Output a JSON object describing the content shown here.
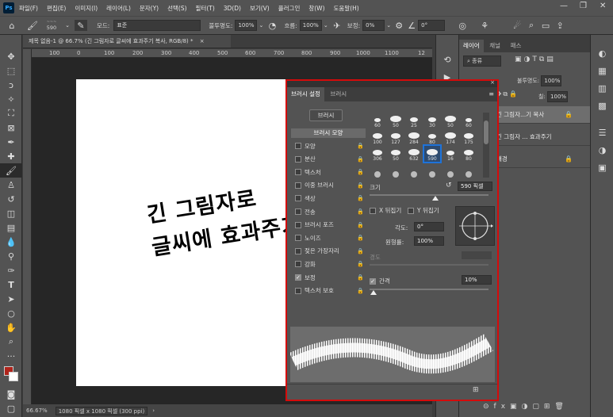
{
  "menubar": {
    "logo": "Ps",
    "items": [
      "파일(F)",
      "편집(E)",
      "이미지(I)",
      "레이어(L)",
      "문자(Y)",
      "선택(S)",
      "필터(T)",
      "3D(D)",
      "보기(V)",
      "플러그인",
      "창(W)",
      "도움말(H)"
    ]
  },
  "options": {
    "brush_size": "590",
    "mode_label": "모드:",
    "mode_value": "표준",
    "opacity_label": "불투명도:",
    "opacity_value": "100%",
    "flow_label": "흐름:",
    "flow_value": "100%",
    "smoothing_label": "보정:",
    "smoothing_value": "0%",
    "angle_value": "0°"
  },
  "document": {
    "tab_title": "제목 없음-1 @ 66.7% (긴 그림자로 글씨에 효과주기 복사, RGB/8) *",
    "text_line1": "긴 그림자로",
    "text_line2": "글씨에 효과주기",
    "ruler_ticks": [
      "100",
      "0",
      "100",
      "200",
      "300",
      "400",
      "500",
      "600",
      "700",
      "800",
      "900",
      "1000",
      "1100",
      "12"
    ]
  },
  "status": {
    "zoom": "66.67%",
    "size": "1080 픽셀 x 1080 픽셀 (300 ppi)"
  },
  "layers_panel": {
    "tabs": [
      "레이어",
      "채널",
      "패스"
    ],
    "filter_label": "종류",
    "opacity_label": "불투명도:",
    "opacity_value": "100%",
    "fill_label": "칠:",
    "fill_value": "100%",
    "layers": [
      {
        "name": "긴 그림자...기 복사",
        "selected": true
      },
      {
        "name": "긴 그림자 ... 효과주기",
        "selected": false
      },
      {
        "name": "배경",
        "selected": false
      }
    ]
  },
  "brush_settings": {
    "tabs": [
      "브러시 설정",
      "브러시"
    ],
    "brushes_button": "브러시",
    "shape_title": "브러시 모양",
    "options": [
      {
        "label": "모양",
        "checked": false,
        "locked": true
      },
      {
        "label": "분산",
        "checked": false,
        "locked": true
      },
      {
        "label": "텍스처",
        "checked": false,
        "locked": true
      },
      {
        "label": "이중 브러시",
        "checked": false,
        "locked": true
      },
      {
        "label": "색상",
        "checked": false,
        "locked": true
      },
      {
        "label": "전송",
        "checked": false,
        "locked": true
      },
      {
        "label": "브러시 포즈",
        "checked": false,
        "locked": true
      },
      {
        "label": "노이즈",
        "checked": false,
        "locked": true
      },
      {
        "label": "젖은 가장자리",
        "checked": false,
        "locked": true
      },
      {
        "label": "강화",
        "checked": false,
        "locked": true
      },
      {
        "label": "보정",
        "checked": true,
        "locked": true
      },
      {
        "label": "텍스처 보호",
        "checked": false,
        "locked": true
      }
    ],
    "tip_sizes": [
      "60",
      "50",
      "25",
      "30",
      "50",
      "60",
      "100",
      "127",
      "284",
      "80",
      "174",
      "175",
      "306",
      "50",
      "632",
      "590",
      "16",
      "80",
      "",
      "",
      "",
      "",
      "",
      ""
    ],
    "selected_tip": 15,
    "size_label": "크기",
    "size_value": "590 픽셀",
    "size_fraction": 0.55,
    "flip_x": "X 뒤집기",
    "flip_y": "Y 뒤집기",
    "angle_label": "각도:",
    "angle_value": "0°",
    "roundness_label": "원형률:",
    "roundness_value": "100%",
    "hardness_label": "경도",
    "spacing_label": "간격",
    "spacing_checked": true,
    "spacing_value": "10%",
    "spacing_fraction": 0.03
  }
}
